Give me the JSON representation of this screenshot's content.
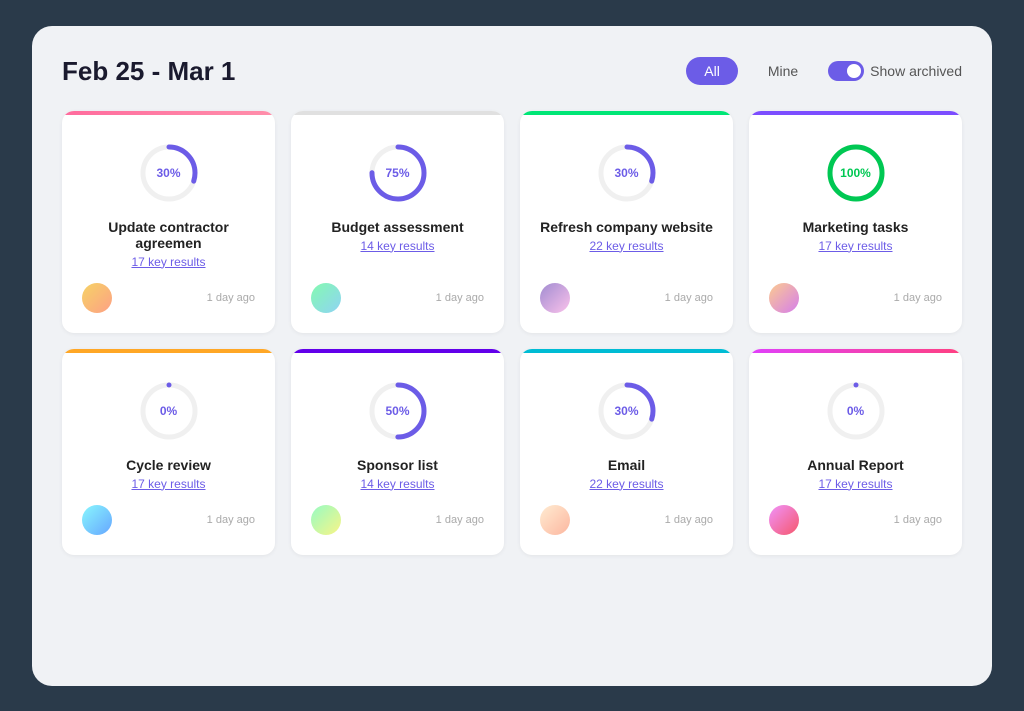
{
  "header": {
    "date_range": "Feb 25 - Mar 1",
    "filter_all": "All",
    "filter_mine": "Mine",
    "show_archived_label": "Show archived"
  },
  "cards": [
    {
      "id": 1,
      "border_class": "pink",
      "percent": 30,
      "title": "Update contractor agreemen",
      "key_results": "17 key results",
      "timestamp": "1 day ago",
      "avatar_class": "avatar-1",
      "avatar_emoji": "👤",
      "stroke_color": "#6c5ce7",
      "circumference": 163.4,
      "dash": 48.9
    },
    {
      "id": 2,
      "border_class": "gray",
      "percent": 75,
      "title": "Budget assessment",
      "key_results": "14 key results",
      "timestamp": "1 day ago",
      "avatar_class": "avatar-2",
      "avatar_emoji": "👤",
      "stroke_color": "#6c5ce7",
      "circumference": 163.4,
      "dash": 122.6
    },
    {
      "id": 3,
      "border_class": "green",
      "percent": 30,
      "title": "Refresh company website",
      "key_results": "22 key results",
      "timestamp": "1 day ago",
      "avatar_class": "avatar-3",
      "avatar_emoji": "👤",
      "stroke_color": "#6c5ce7",
      "circumference": 163.4,
      "dash": 48.9
    },
    {
      "id": 4,
      "border_class": "purple",
      "percent": 100,
      "title": "Marketing tasks",
      "key_results": "17 key results",
      "timestamp": "1 day ago",
      "avatar_class": "avatar-4",
      "avatar_emoji": "👤",
      "stroke_color": "#00c853",
      "circumference": 163.4,
      "dash": 163.4
    },
    {
      "id": 5,
      "border_class": "orange",
      "percent": 0,
      "title": "Cycle review",
      "key_results": "17 key results",
      "timestamp": "1 day ago",
      "avatar_class": "avatar-5",
      "avatar_emoji": "👤",
      "stroke_color": "#6c5ce7",
      "circumference": 163.4,
      "dash": 0
    },
    {
      "id": 6,
      "border_class": "deep-purple",
      "percent": 50,
      "title": "Sponsor list",
      "key_results": "14 key results",
      "timestamp": "1 day ago",
      "avatar_class": "avatar-6",
      "avatar_emoji": "👤",
      "stroke_color": "#6c5ce7",
      "circumference": 163.4,
      "dash": 81.7
    },
    {
      "id": 7,
      "border_class": "cyan",
      "percent": 30,
      "title": "Email",
      "key_results": "22 key results",
      "timestamp": "1 day ago",
      "avatar_class": "avatar-7",
      "avatar_emoji": "👤",
      "stroke_color": "#6c5ce7",
      "circumference": 163.4,
      "dash": 48.9
    },
    {
      "id": 8,
      "border_class": "magenta",
      "percent": 0,
      "title": "Annual Report",
      "key_results": "17 key results",
      "timestamp": "1 day ago",
      "avatar_class": "avatar-8",
      "avatar_emoji": "👤",
      "stroke_color": "#6c5ce7",
      "circumference": 163.4,
      "dash": 0
    }
  ]
}
